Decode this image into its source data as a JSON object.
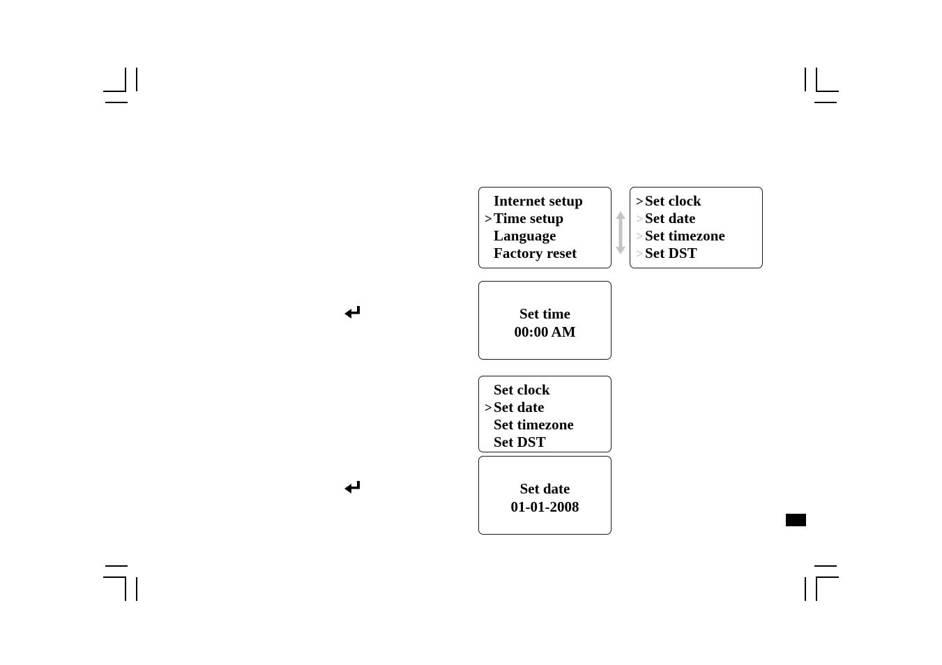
{
  "page": {
    "background_color": "#ffffff",
    "ink_color": "#000000",
    "dim_color": "#c6c6c6"
  },
  "marks": {
    "crop_mark_name": "crop-mark",
    "page_marker_name": "page-marker"
  },
  "panels": {
    "setup_menu": {
      "name": "Setup menu display",
      "rows": [
        {
          "chevron": "",
          "label": "Internet setup",
          "selected": false
        },
        {
          "chevron": ">",
          "label": "Time setup",
          "selected": true
        },
        {
          "chevron": "",
          "label": "Language",
          "selected": false
        },
        {
          "chevron": "",
          "label": "Factory reset",
          "selected": false
        }
      ]
    },
    "time_setup_menu": {
      "name": "Time setup menu display",
      "rows": [
        {
          "chevron": ">",
          "label": "Set clock",
          "selected": true
        },
        {
          "chevron": ">",
          "label": "Set date",
          "selected": false
        },
        {
          "chevron": ">",
          "label": "Set timezone",
          "selected": false
        },
        {
          "chevron": ">",
          "label": "Set DST",
          "selected": false
        }
      ]
    },
    "set_time_value": {
      "name": "Set time display",
      "title": "Set time",
      "value": "00:00 AM"
    },
    "clock_menu": {
      "name": "Clock menu display",
      "rows": [
        {
          "chevron": "",
          "label": "Set clock",
          "selected": false
        },
        {
          "chevron": ">",
          "label": "Set date",
          "selected": true
        },
        {
          "chevron": "",
          "label": "Set timezone",
          "selected": false
        },
        {
          "chevron": "",
          "label": "Set DST",
          "selected": false
        }
      ]
    },
    "set_date_value": {
      "name": "Set date display",
      "title": "Set date",
      "value": "01-01-2008"
    }
  },
  "glyphs": {
    "updown_arrow": "scroll-up-down-arrow",
    "return_arrow": "↵",
    "return_arrow_upper_name": "return-arrow-set-time",
    "return_arrow_lower_name": "return-arrow-set-date"
  }
}
